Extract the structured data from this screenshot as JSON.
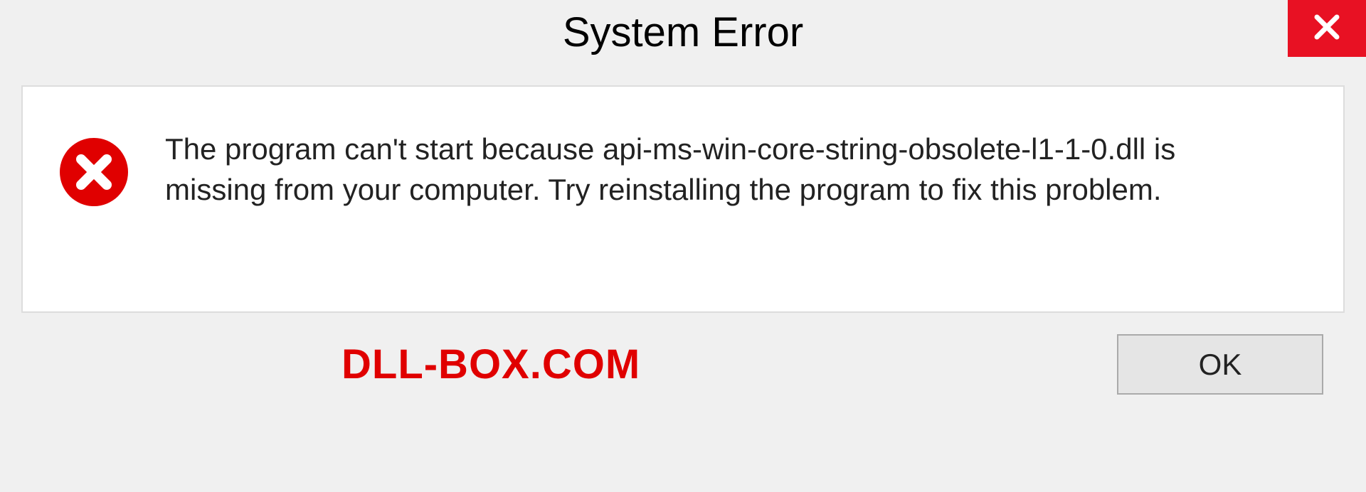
{
  "dialog": {
    "title": "System Error",
    "message": "The program can't start because api-ms-win-core-string-obsolete-l1-1-0.dll is missing from your computer. Try reinstalling the program to fix this problem.",
    "ok_label": "OK"
  },
  "watermark": "DLL-BOX.COM",
  "colors": {
    "close_bg": "#e81123",
    "error_red": "#e00000",
    "watermark_red": "#e00000"
  }
}
